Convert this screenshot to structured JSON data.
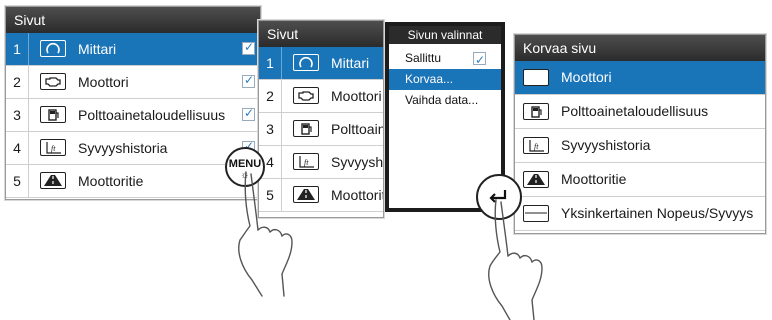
{
  "panel1": {
    "title": "Sivut",
    "rows": [
      {
        "num": "1",
        "label": "Mittari",
        "icon": "gauge-icon",
        "checked": true
      },
      {
        "num": "2",
        "label": "Moottori",
        "icon": "engine-icon",
        "checked": true
      },
      {
        "num": "3",
        "label": "Polttoainetaloudellisuus",
        "icon": "fuel-icon",
        "checked": true
      },
      {
        "num": "4",
        "label": "Syvyyshistoria",
        "icon": "depth-history-icon",
        "checked": true
      },
      {
        "num": "5",
        "label": "Moottoritie",
        "icon": "highway-icon",
        "checked": false
      }
    ]
  },
  "panel2": {
    "title": "Sivut",
    "rows": [
      {
        "num": "1",
        "label": "Mittari"
      },
      {
        "num": "2",
        "label": "Moottori"
      },
      {
        "num": "3",
        "label": "Polttoainetaloudellisuus"
      },
      {
        "num": "4",
        "label": "Syvyyshistoria"
      },
      {
        "num": "5",
        "label": "Moottoritie"
      }
    ]
  },
  "menu": {
    "title": "Sivun valinnat",
    "items": [
      {
        "label": "Sallittu",
        "checked": true
      },
      {
        "label": "Korvaa...",
        "selected": true
      },
      {
        "label": "Vaihda data..."
      }
    ]
  },
  "replace": {
    "title": "Korvaa sivu",
    "rows": [
      {
        "label": "Moottori",
        "icon": "engine-icon"
      },
      {
        "label": "Polttoainetaloudellisuus",
        "icon": "fuel-icon"
      },
      {
        "label": "Syvyyshistoria",
        "icon": "depth-history-icon"
      },
      {
        "label": "Moottoritie",
        "icon": "highway-icon"
      },
      {
        "label": "Yksinkertainen Nopeus/Syvyys",
        "icon": "speed-depth-icon"
      }
    ]
  },
  "menu_button": {
    "label": "MENU",
    "icon": "sun-icon"
  },
  "enter_button": {
    "icon": "enter-icon"
  },
  "colors": {
    "selection": "#1a75b8",
    "title_bar": "#2b2b2b"
  }
}
